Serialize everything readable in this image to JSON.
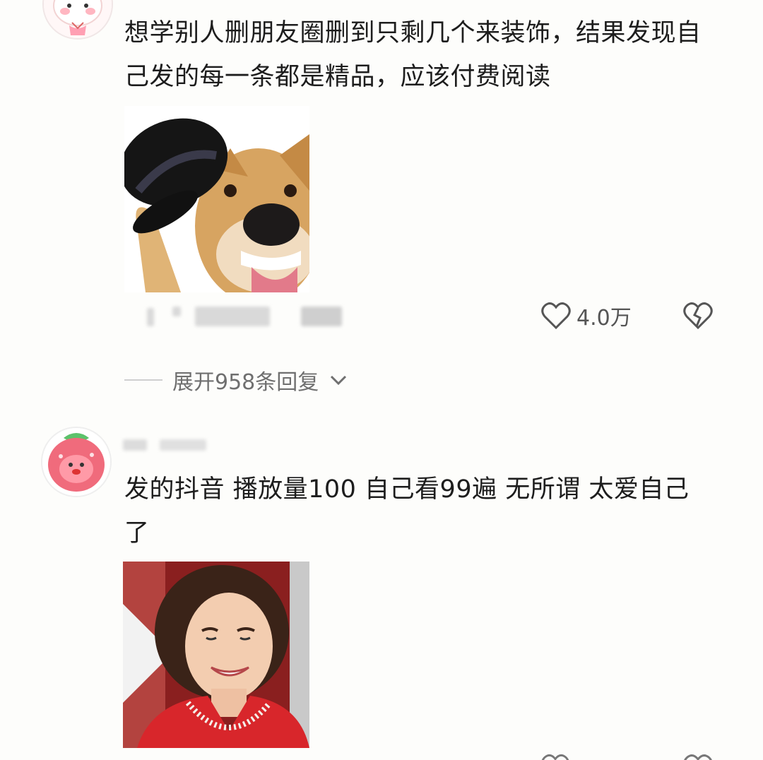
{
  "comments": [
    {
      "text": "想学别人删朋友圈删到只剩几个来装饰，结果发现自己发的每一条都是精品，应该付费阅读",
      "avatar_icon": "bunny-avatar-icon",
      "image_icon": "dog-tipping-hat-meme-icon",
      "like_count": "4.0万",
      "reply_action_label": "回复",
      "expand_label": "展开958条回复"
    },
    {
      "text": "发的抖音 播放量100 自己看99遍 无所谓 太爱自己了",
      "avatar_icon": "strawberry-avatar-icon",
      "image_icon": "laughing-woman-meme-icon"
    }
  ],
  "icons": {
    "like": "heart-icon",
    "dislike": "broken-heart-icon",
    "expand": "chevron-down-icon"
  },
  "colors": {
    "background": "#fdfdfb",
    "text": "#1d1d1d",
    "secondary": "#6f6f6f"
  }
}
